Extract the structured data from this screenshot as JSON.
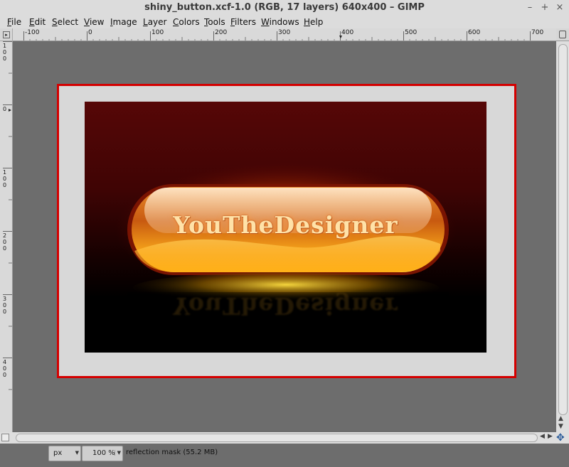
{
  "window": {
    "title": "shiny_button.xcf-1.0 (RGB, 17 layers) 640x400 – GIMP",
    "minimize_label": "–",
    "maximize_label": "+",
    "close_label": "×"
  },
  "menu": [
    {
      "key": "F",
      "rest": "ile"
    },
    {
      "key": "E",
      "rest": "dit"
    },
    {
      "key": "S",
      "rest": "elect"
    },
    {
      "key": "V",
      "rest": "iew"
    },
    {
      "key": "I",
      "rest": "mage"
    },
    {
      "key": "L",
      "rest": "ayer"
    },
    {
      "key": "C",
      "rest": "olors"
    },
    {
      "key": "T",
      "rest": "ools"
    },
    {
      "key": "F",
      "rest": "ilters"
    },
    {
      "key": "W",
      "rest": "indows"
    },
    {
      "key": "H",
      "rest": "elp"
    }
  ],
  "ruler": {
    "h_labels": [
      "-100",
      "0",
      "100",
      "200",
      "300",
      "400",
      "500",
      "600",
      "700"
    ],
    "v_labels": [
      "0",
      "100",
      "200",
      "300",
      "400"
    ],
    "v_pre": "100"
  },
  "image": {
    "text": "YouTheDesigner"
  },
  "statusbar": {
    "unit": "px",
    "zoom": "100 %",
    "message": "reflection mask (55.2 MB)"
  },
  "colors": {
    "frame_border": "#d40000",
    "canvas_bg": "#6d6d6d"
  }
}
